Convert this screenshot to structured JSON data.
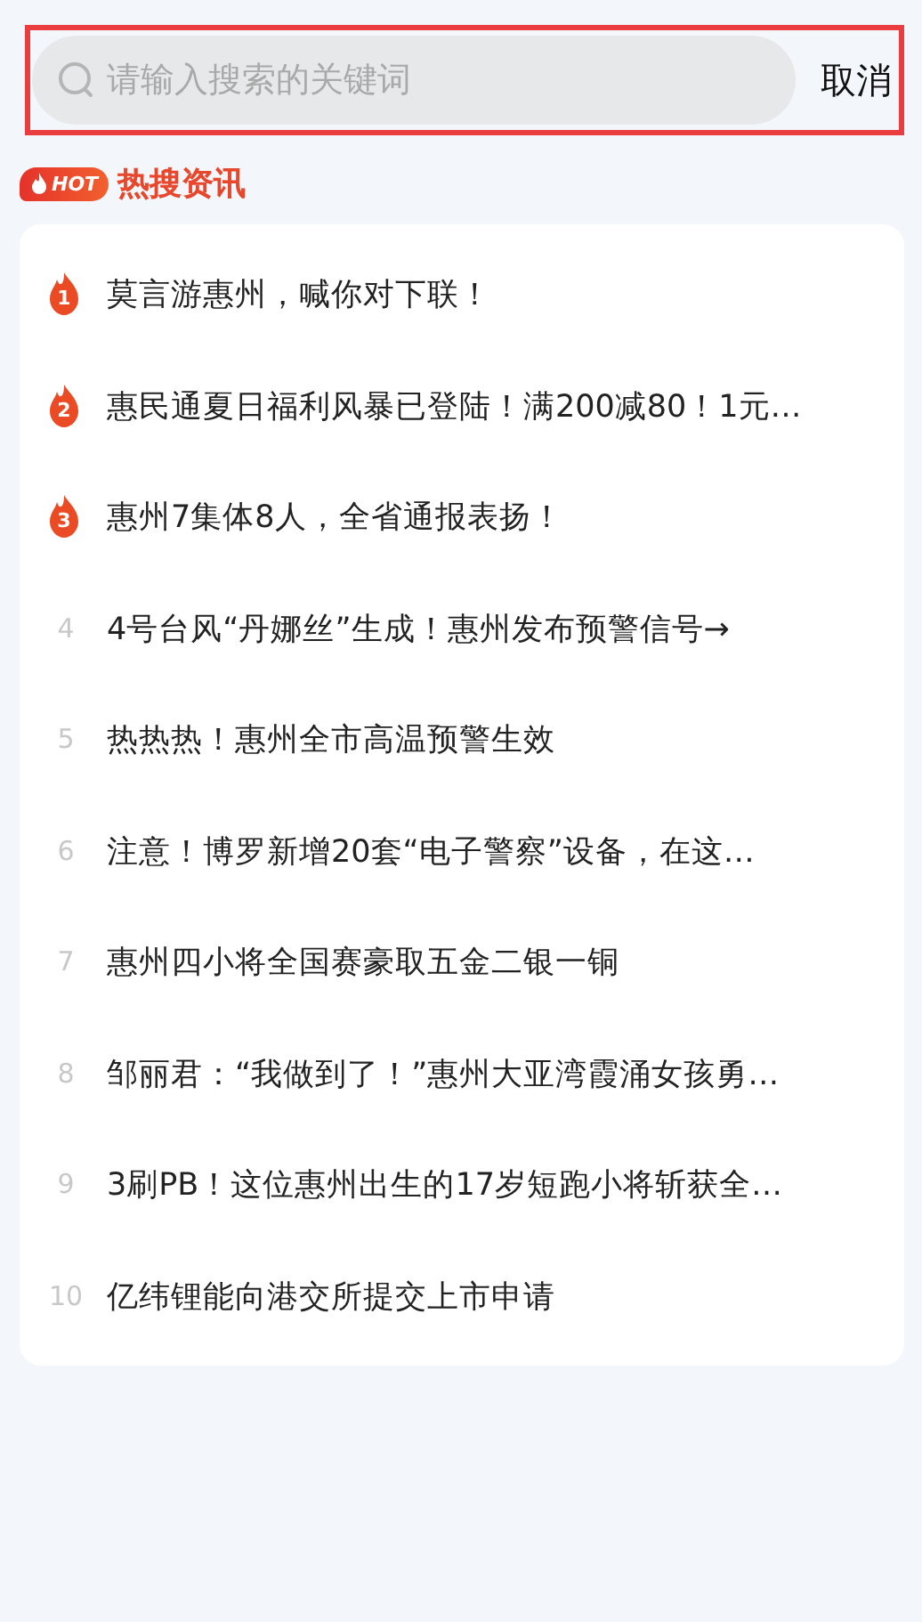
{
  "search": {
    "placeholder": "请输入搜索的关键词",
    "highlighted": true,
    "cancel": "取消"
  },
  "section": {
    "badge": "HOT",
    "title": "热搜资讯"
  },
  "items": [
    {
      "kind": "hot",
      "rank": "1",
      "title": "莫言游惠州，喊你对下联！"
    },
    {
      "kind": "hot",
      "rank": "2",
      "title": "惠民通夏日福利风暴已登陆！满200减80！1元…"
    },
    {
      "kind": "hot",
      "rank": "3",
      "title": "惠州7集体8人，全省通报表扬！"
    },
    {
      "kind": "plain",
      "rank": "4",
      "title": "4号台风“丹娜丝”生成！惠州发布预警信号→"
    },
    {
      "kind": "plain",
      "rank": "5",
      "title": "热热热！惠州全市高温预警生效"
    },
    {
      "kind": "plain",
      "rank": "6",
      "title": "注意！博罗新增20套“电子警察”设备，在这…"
    },
    {
      "kind": "plain",
      "rank": "7",
      "title": "惠州四小将全国赛豪取五金二银一铜"
    },
    {
      "kind": "plain",
      "rank": "8",
      "title": "邹丽君：“我做到了！”惠州大亚湾霞涌女孩勇…"
    },
    {
      "kind": "plain",
      "rank": "9",
      "title": "3刷PB！这位惠州出生的17岁短跑小将斩获全…"
    },
    {
      "kind": "plain",
      "rank": "10",
      "title": "亿纬锂能向港交所提交上市申请"
    }
  ]
}
